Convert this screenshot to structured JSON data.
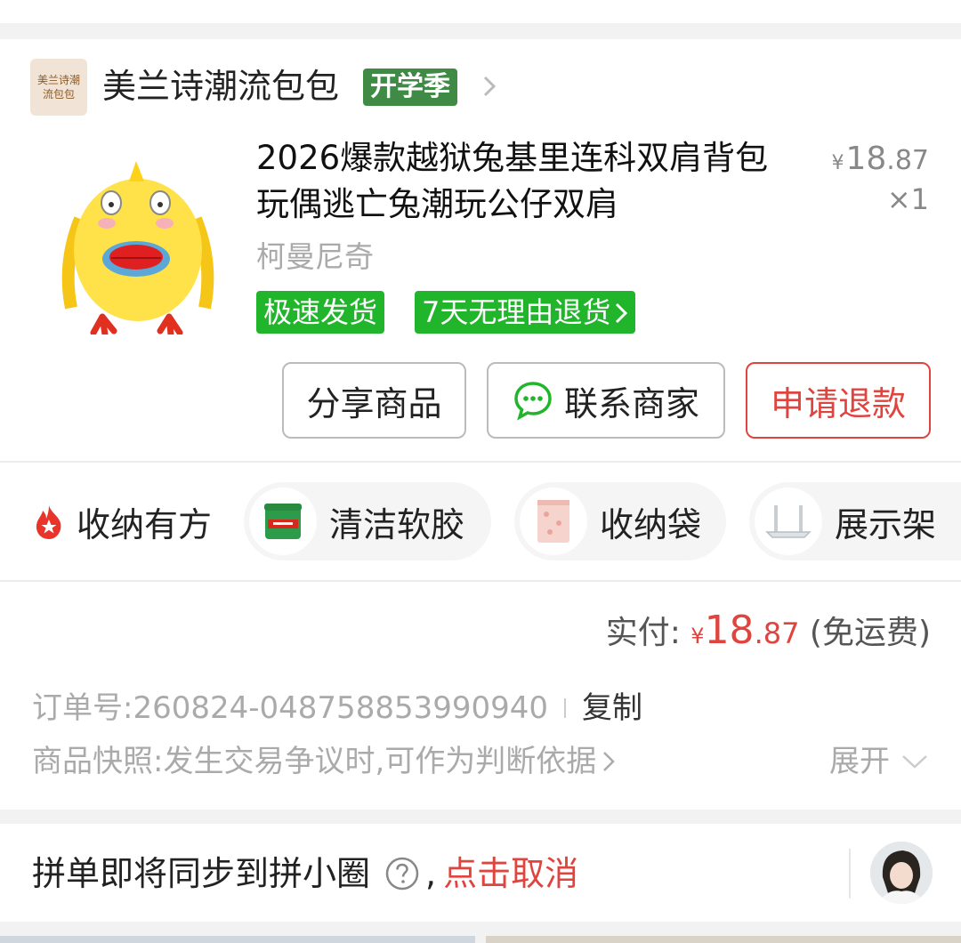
{
  "shop": {
    "logo_text": "美兰诗潮流包包",
    "name": "美兰诗潮流包包",
    "tag": "开学季"
  },
  "product": {
    "title": "2026爆款越狱兔基里连科双肩背包玩偶逃亡兔潮玩公仔双肩",
    "price_yen": "¥",
    "price_int": "18",
    "price_dec": ".87",
    "quantity": "×1",
    "sku": "柯曼尼奇",
    "badge_fast": "极速发货",
    "badge_return": "7天无理由退货",
    "image_icon": "yellow-chick-backpack"
  },
  "actions": {
    "share": "分享商品",
    "contact": "联系商家",
    "refund": "申请退款"
  },
  "storage": {
    "label": "收纳有方",
    "chips": [
      {
        "label": "清洁软胶",
        "icon": "cleaning-gel-jar"
      },
      {
        "label": "收纳袋",
        "icon": "storage-bag"
      },
      {
        "label": "展示架",
        "icon": "display-stand"
      }
    ]
  },
  "payment": {
    "label": "实付:",
    "yen": "¥",
    "amount_int": "18",
    "amount_dec": ".87",
    "shipping": "(免运费)"
  },
  "order": {
    "number_label": "订单号:",
    "number": "260824-048758853990940",
    "copy": "复制",
    "snapshot_label": "商品快照:",
    "snapshot_text": "发生交易争议时,可作为判断依据",
    "expand": "展开"
  },
  "group": {
    "text": "拼单即将同步到拼小圈",
    "comma": ",",
    "cancel": "点击取消"
  },
  "colors": {
    "accent_red": "#e0443e",
    "green_badge": "#21b52b",
    "shop_tag_green": "#3f8b46"
  }
}
